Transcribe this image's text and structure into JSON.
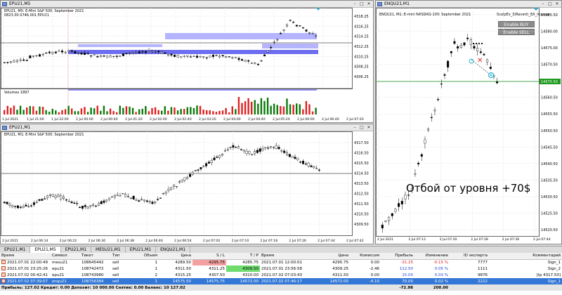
{
  "colors": {
    "buy": "#0b7a0b",
    "sell": "#e02020",
    "level_band": "#6e6ef0",
    "level_band_light": "#b4b4ff",
    "highlight_red": "#f2a0a0",
    "highlight_green": "#6fdc6f",
    "selected_row": "#3378d6",
    "level_line": "#1f9a1f"
  },
  "windows": {
    "epu21_m5": {
      "title": "EPU21,M5",
      "symbol_line": "EPU21, M5: E-Mini S&P 500: September 2021",
      "ohlc_line": "0823.00 0746.001 EPU21",
      "volume_label": "Volumes 1897",
      "price_axis": [
        "4318.25",
        "4316.25",
        "4314.25",
        "4312.25",
        "4310.25",
        "4308.25",
        "4306.25"
      ],
      "volume_axis": [
        "2710",
        "0"
      ],
      "time_axis": [
        "1 Jul 2021",
        "1 Jul 21:00",
        "1 Jul 22:00",
        "2 Jul 00:00",
        "2 Jul 00:40",
        "2 Jul 01:20",
        "2 Jul 02:00",
        "2 Jul 02:40",
        "2 Jul 03:20",
        "2 Jul 04:00",
        "2 Jul 04:40",
        "2 Jul 05:20",
        "2 Jul 06:00",
        "2 Jul 06:40",
        "2 Jul 07:20"
      ]
    },
    "epu21_m1": {
      "title": "EPU21,M1",
      "symbol_line": "EPU21, M1: E-Mini S&P 500: September 2021",
      "price_axis": [
        "4317.50",
        "4316.50",
        "4315.50",
        "4314.50",
        "4313.50",
        "4312.50",
        "4311.50",
        "4310.50",
        "4309.50"
      ],
      "time_axis": [
        "2 Jul 2021",
        "2 Jul 06:14",
        "2 Jul 06:22",
        "2 Jul 06:30",
        "2 Jul 06:38",
        "2 Jul 06:46",
        "2 Jul 06:54",
        "2 Jul 07:02",
        "2 Jul 07:10",
        "2 Jul 07:18",
        "2 Jul 07:26",
        "2 Jul 07:34",
        "2 Jul 07:42"
      ]
    },
    "enqu21_m1": {
      "title": "ENQU21,M1",
      "symbol_line": "ENQU21, M1: E-mini NASDAQ-100: September 2021",
      "ea_name": "ScalpEx_3(Revert)_EA_licence",
      "buy_button": "Enable BUY",
      "sell_button": "Enable SELL",
      "annotation": "Отбой от уровня +70$",
      "price_axis": [
        "14585.50",
        "14580.00",
        "14575.00",
        "14570.50",
        "14565.50",
        "14560.50",
        "14555.50",
        "14550.50",
        "14545.50",
        "14540.50",
        "14535.50",
        "14530.50",
        "14525.50",
        "14520.50"
      ],
      "current_price": "14575.50",
      "time_axis": [
        "2 Jul 2021",
        "2 Jul 07:12",
        "2 Jul 07:20",
        "2 Jul 07:28",
        "2 Jul 07:36",
        "2 Jul 07:44"
      ]
    }
  },
  "tabs": [
    {
      "label": "EPU21,M1",
      "active": false
    },
    {
      "label": "EPU21,M5",
      "active": true
    },
    {
      "label": "EPU21,M1",
      "active": false
    },
    {
      "label": "MESU21,M1",
      "active": false
    },
    {
      "label": "EPU21,M1",
      "active": false
    },
    {
      "label": "ENQU21,M1",
      "active": false
    }
  ],
  "terminal": {
    "columns": [
      "Время",
      "Символ",
      "Тикет",
      "Тип",
      "Объем",
      "Цена",
      "S / L",
      "T / P",
      "Время",
      "Цена",
      "Комиссия",
      "Прибыль",
      "Изменение",
      "ID эксперта",
      "Комментарий"
    ],
    "rows": [
      [
        "2021.07.01 22:00:49",
        "mesu21",
        "108645442",
        "sell",
        "1",
        "4289.50",
        "4295.75",
        "4285.75",
        "2021.07.01 12:00:01",
        "4295.75",
        "0.00",
        "-31.25",
        "-0.15 %",
        "7777",
        "Sign_1"
      ],
      [
        "2021.07.01 23:25:26",
        "epu21",
        "108742472",
        "sell",
        "1",
        "4311.50",
        "4311.25",
        "4309.50",
        "2021.07.01 23:56:58",
        "4309.25",
        "-2.46",
        "112.50",
        "0.05 %",
        "1111",
        "Sign_2"
      ],
      [
        "2021.07.02 00:42:41",
        "epu21",
        "108743980",
        "sell",
        "2",
        "4315.25",
        "4307.50",
        "4310.00",
        "2021.07.02 07:03:43",
        "4311.50",
        "0.00",
        "15.00",
        "0.03 %",
        "9876",
        "[tp 4317.50]"
      ],
      [
        "2021.07.02 07:39:07",
        "enqu21",
        "108756384",
        "sell",
        "1",
        "14575.50",
        "14575.75",
        "14572.00",
        "2021.07.02 07:46:17",
        "14572.00",
        "-4.10",
        "70.00",
        "0.02 %",
        "2222",
        "Sign_1"
      ]
    ],
    "sl_highlight_row": 0,
    "tp_highlight_row": 1,
    "selected_row": 3,
    "summary": "Прибыль: 127.02  Кредит: 0.00  Депозит: 10 000.00  Снятие: 0.00  Баланс: 10 127.02",
    "summary_profit": "-72.98",
    "summary_total": "200.00"
  }
}
